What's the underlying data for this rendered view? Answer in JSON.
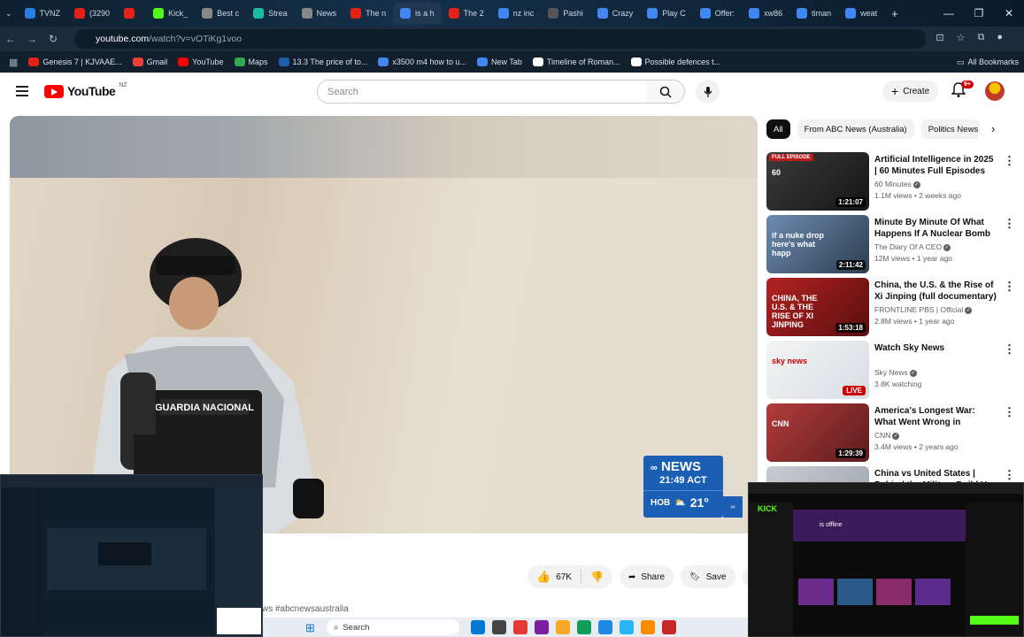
{
  "browser": {
    "tabs": [
      {
        "label": "TVNZ",
        "color": "#2a7de1"
      },
      {
        "label": "(3290",
        "color": "#e62117"
      },
      {
        "label": "",
        "color": "#e62117"
      },
      {
        "label": "Kick_",
        "color": "#53fc18"
      },
      {
        "label": "Best c",
        "color": "#888888"
      },
      {
        "label": "Strea",
        "color": "#1abc9c"
      },
      {
        "label": "News",
        "color": "#888888"
      },
      {
        "label": "The n",
        "color": "#e62117"
      },
      {
        "label": "is a h",
        "color": "#4285f4"
      },
      {
        "label": "The 2",
        "color": "#e62117"
      },
      {
        "label": "nz inc",
        "color": "#4285f4"
      },
      {
        "label": "Pashi",
        "color": "#555555"
      },
      {
        "label": "Crazy",
        "color": "#4285f4"
      },
      {
        "label": "Play C",
        "color": "#4285f4"
      },
      {
        "label": "Offer:",
        "color": "#4285f4"
      },
      {
        "label": "xw86",
        "color": "#4285f4"
      },
      {
        "label": "timan",
        "color": "#4285f4"
      },
      {
        "label": "weat",
        "color": "#4285f4"
      }
    ],
    "new_tab_glyph": "+",
    "window_controls": [
      "—",
      "❐",
      "✕"
    ],
    "url_host": "youtube.com",
    "url_path": "/watch?v=vOTiKg1voo",
    "bookmarks": [
      {
        "label": "Genesis 7 | KJVAAE...",
        "color": "#e62117"
      },
      {
        "label": "Gmail",
        "color": "#ea4335"
      },
      {
        "label": "YouTube",
        "color": "#ff0000"
      },
      {
        "label": "Maps",
        "color": "#34a853"
      },
      {
        "label": "13.3 The price of to...",
        "color": "#1f5fae"
      },
      {
        "label": "x3500 m4 how to u...",
        "color": "#4285f4"
      },
      {
        "label": "New Tab",
        "color": "#4285f4"
      },
      {
        "label": "Timeline of Roman...",
        "color": "#ffffff"
      },
      {
        "label": "Possible defences t...",
        "color": "#ffffff"
      }
    ],
    "all_bookmarks": "All Bookmarks"
  },
  "youtube": {
    "logo_word": "YouTube",
    "country": "NZ",
    "search_placeholder": "Search",
    "create_label": "Create",
    "notif_count": "9+",
    "player": {
      "vest_text": "GUARDIA NACIONAL",
      "abc_brand": "NEWS",
      "abc_time": "21:49",
      "abc_tz": "ACT",
      "abc_city": "HOB",
      "abc_temp": "21°"
    },
    "actions": {
      "likes": "67K",
      "share": "Share",
      "save": "Save"
    },
    "hashtags": "ws #abcnewsaustralia",
    "chips": [
      "All",
      "From ABC News (Australia)",
      "Politics News"
    ],
    "recommendations": [
      {
        "title": "Artificial Intelligence in 2025 | 60 Minutes Full Episodes",
        "channel": "60 Minutes",
        "meta": "1.1M views • 2 weeks ago",
        "duration": "1:21:07",
        "badge": "FULL EPISODE",
        "thumb_text": "60",
        "c1": "#3b3b3b",
        "c2": "#151515"
      },
      {
        "title": "Minute By Minute Of What Happens If A Nuclear Bomb ...",
        "channel": "The Diary Of A CEO",
        "meta": "12M views • 1 year ago",
        "duration": "2:11:42",
        "badge": "",
        "thumb_text": "if a nuke drop here's what happ",
        "c1": "#6d8bb0",
        "c2": "#2c3e50"
      },
      {
        "title": "China, the U.S. & the Rise of Xi Jinping (full documentary) | ...",
        "channel": "FRONTLINE PBS | Official",
        "meta": "2.8M views • 1 year ago",
        "duration": "1:53:18",
        "badge": "",
        "thumb_text": "CHINA, THE U.S. & THE RISE OF XI JINPING",
        "c1": "#b22222",
        "c2": "#5a0e0e"
      },
      {
        "title": "Watch Sky News",
        "channel": "Sky News",
        "meta": "3.8K watching",
        "duration": "LIVE",
        "badge": "",
        "thumb_text": "sky news",
        "c1": "#f4f4f4",
        "c2": "#d8dde3"
      },
      {
        "title": "America's Longest War: What Went Wrong in Afghanistan ...",
        "channel": "CNN",
        "meta": "3.4M views • 2 years ago",
        "duration": "1:29:39",
        "badge": "",
        "thumb_text": "CNN",
        "c1": "#b43b3b",
        "c2": "#5b1d1d"
      },
      {
        "title": "China vs United States | Behind the Military Build Up",
        "channel": "",
        "meta": "",
        "duration": "",
        "badge": "",
        "thumb_text": "",
        "c1": "#c7ccd3",
        "c2": "#9aa3ad"
      }
    ]
  },
  "taskbar": {
    "search_label": "Search",
    "icons": [
      "#0078d4",
      "#444444",
      "#e53935",
      "#7b1fa2",
      "#f9a825",
      "#0f9d58",
      "#1e88e5",
      "#29b6f6",
      "#fb8c00",
      "#c62828"
    ]
  },
  "mini_right": {
    "brand": "KICK",
    "status": "is offline"
  }
}
